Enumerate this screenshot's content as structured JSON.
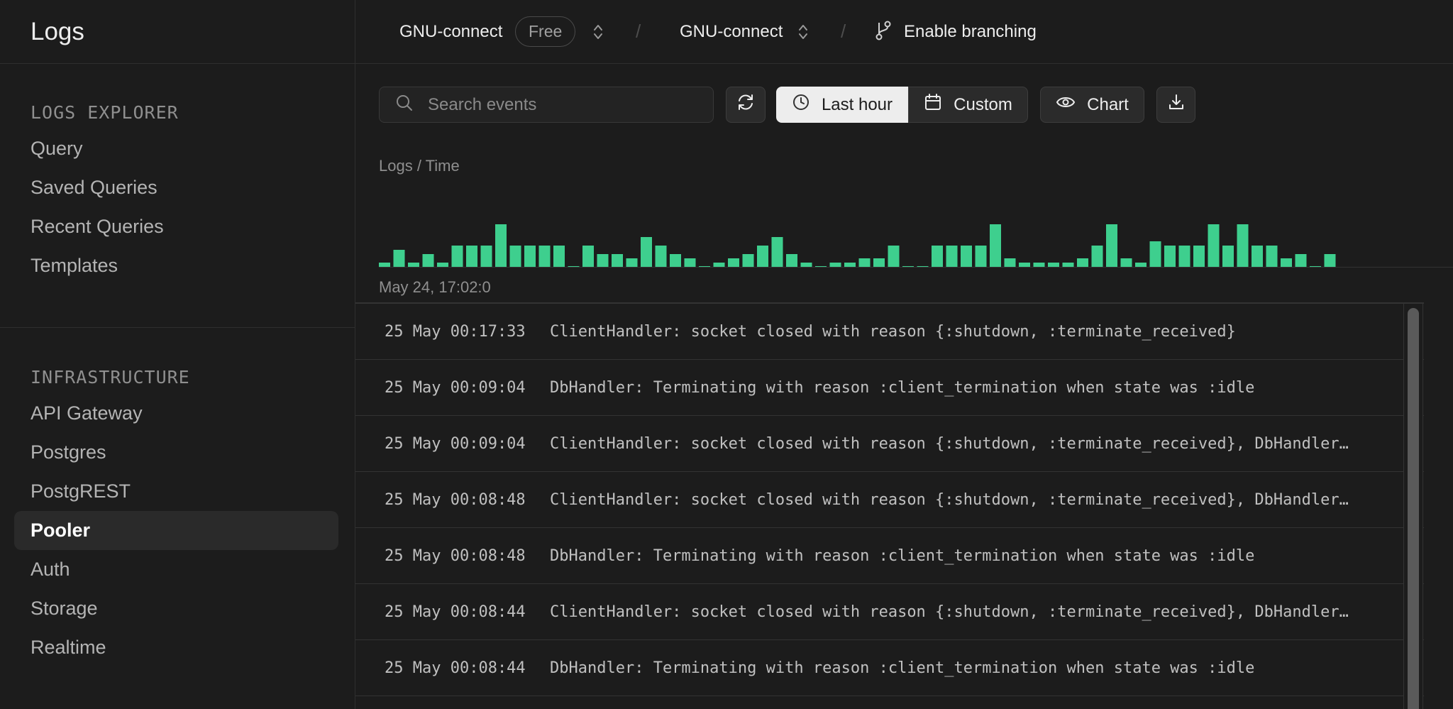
{
  "sidebar": {
    "title": "Logs",
    "explorer": {
      "heading": "LOGS EXPLORER",
      "items": [
        {
          "label": "Query"
        },
        {
          "label": "Saved Queries"
        },
        {
          "label": "Recent Queries"
        },
        {
          "label": "Templates"
        }
      ]
    },
    "infrastructure": {
      "heading": "INFRASTRUCTURE",
      "items": [
        {
          "label": "API Gateway"
        },
        {
          "label": "Postgres"
        },
        {
          "label": "PostgREST"
        },
        {
          "label": "Pooler",
          "active": true
        },
        {
          "label": "Auth"
        },
        {
          "label": "Storage"
        },
        {
          "label": "Realtime"
        }
      ]
    }
  },
  "topbar": {
    "org": "GNU-connect",
    "plan_badge": "Free",
    "project": "GNU-connect",
    "branching": "Enable branching",
    "separator": "/"
  },
  "toolbar": {
    "search_placeholder": "Search events",
    "last_hour": "Last hour",
    "custom": "Custom",
    "chart": "Chart"
  },
  "chart_data": {
    "type": "bar",
    "title": "Logs / Time",
    "x_start_label": "May 24, 17:02:0",
    "bar_color": "#3ecf8e",
    "values": [
      1,
      4,
      1,
      3,
      1,
      5,
      5,
      5,
      10,
      5,
      5,
      5,
      5,
      0,
      5,
      3,
      3,
      2,
      7,
      5,
      3,
      2,
      0,
      1,
      2,
      3,
      5,
      7,
      3,
      1,
      0,
      1,
      1,
      2,
      2,
      5,
      0,
      0,
      5,
      5,
      5,
      5,
      10,
      2,
      1,
      1,
      1,
      1,
      2,
      5,
      10,
      2,
      1,
      6,
      5,
      5,
      5,
      10,
      5,
      10,
      5,
      5,
      2,
      3,
      0,
      3,
      2
    ],
    "ylim": [
      0,
      10
    ]
  },
  "logs": [
    {
      "ts": "25 May 00:17:33",
      "msg": "ClientHandler: socket closed with reason {:shutdown, :terminate_received}"
    },
    {
      "ts": "25 May 00:09:04",
      "msg": "DbHandler: Terminating with reason :client_termination when state was :idle"
    },
    {
      "ts": "25 May 00:09:04",
      "msg": "ClientHandler: socket closed with reason {:shutdown, :terminate_received}, DbHandler…"
    },
    {
      "ts": "25 May 00:08:48",
      "msg": "ClientHandler: socket closed with reason {:shutdown, :terminate_received}, DbHandler…"
    },
    {
      "ts": "25 May 00:08:48",
      "msg": "DbHandler: Terminating with reason :client_termination when state was :idle"
    },
    {
      "ts": "25 May 00:08:44",
      "msg": "ClientHandler: socket closed with reason {:shutdown, :terminate_received}, DbHandler…"
    },
    {
      "ts": "25 May 00:08:44",
      "msg": "DbHandler: Terminating with reason :client_termination when state was :idle"
    }
  ]
}
